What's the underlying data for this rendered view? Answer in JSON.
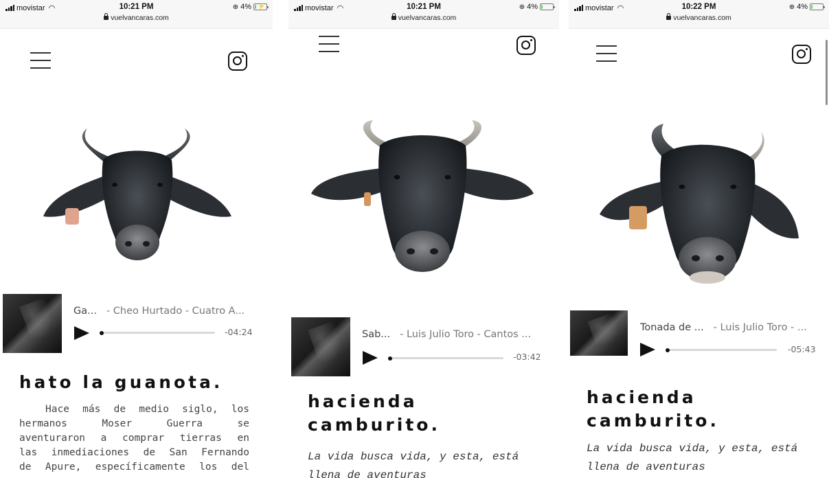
{
  "screens": [
    {
      "status": {
        "carrier": "movistar",
        "time": "10:21 PM",
        "url": "vuelvancaras.com",
        "battery": "4%",
        "charging": true
      },
      "player": {
        "track_title": "Ga...",
        "artist_album": "- Cheo Hurtado - Cuatro A...",
        "time_remaining": "-04:24",
        "progress": 0.0
      },
      "heading": "hato la guanota.",
      "body": [
        "Hace más de medio siglo, los",
        "hermanos Moser Guerra se",
        "aventuraron a comprar tierras en",
        "las inmediaciones de San Fernando",
        "de Apure, específicamente los del"
      ]
    },
    {
      "status": {
        "carrier": "movistar",
        "time": "10:21 PM",
        "url": "vuelvancaras.com",
        "battery": "4%",
        "charging": false
      },
      "player": {
        "track_title": "Sab...",
        "artist_album": "- Luis Julio Toro - Cantos ...",
        "time_remaining": "-03:42",
        "progress": 0.0
      },
      "heading_line1": "hacienda",
      "heading_line2": "camburito.",
      "body": [
        "La vida busca vida, y esta, está",
        "llena de aventuras"
      ]
    },
    {
      "status": {
        "carrier": "movistar",
        "time": "10:22 PM",
        "url": "vuelvancaras.com",
        "battery": "4%",
        "charging": false
      },
      "player": {
        "track_title": "Tonada de ...",
        "artist_album": "- Luis Julio Toro - ...",
        "time_remaining": "-05:43",
        "progress": 0.0
      },
      "heading_line1": "hacienda",
      "heading_line2": "camburito.",
      "body": [
        "La vida busca vida, y esta, está",
        "llena de aventuras"
      ]
    }
  ],
  "icons": {
    "menu": "hamburger-menu-icon",
    "social": "instagram-icon",
    "play": "play-icon",
    "lock": "lock-icon",
    "wifi": "wifi-icon",
    "battery": "battery-icon"
  },
  "colors": {
    "text": "#111111",
    "muted": "#555555",
    "track_bar": "#d8d8d8",
    "battery_fill": "#4cd964"
  }
}
